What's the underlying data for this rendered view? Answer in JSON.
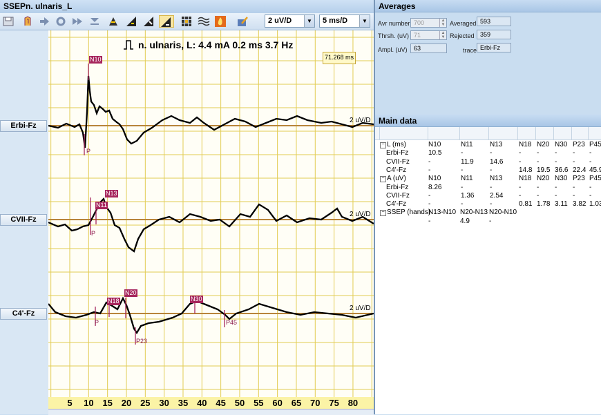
{
  "window": {
    "title": "SSEPn. ulnaris_L"
  },
  "toolbar": {
    "gain_select": "2 uV/D",
    "time_select": "5 ms/D",
    "icons": [
      "save-icon",
      "marker-icon",
      "play-icon",
      "repeat-icon",
      "fast-forward-icon",
      "skip-icon",
      "stimulator-icon",
      "ramp-icon",
      "ramp-alt-icon",
      "overlay-icon",
      "grid-icon",
      "filter-icon",
      "fire-icon",
      "edit-icon"
    ]
  },
  "plot": {
    "stimulus": "n. ulnaris, L: 4.4 mA  0.2 ms 3.7 Hz",
    "cursor_time": "71.268 ms",
    "x_ticks": [
      "5",
      "10",
      "15",
      "20",
      "25",
      "30",
      "35",
      "40",
      "45",
      "50",
      "55",
      "60",
      "65",
      "70",
      "75",
      "80"
    ],
    "channels": [
      {
        "label": "Erbi-Fz",
        "gain": "2 uV/D",
        "markers": [
          "N10"
        ],
        "points": [
          "P"
        ]
      },
      {
        "label": "CVII-Fz",
        "gain": "2 uV/D",
        "markers": [
          "N13",
          "N11"
        ],
        "points": [
          "P"
        ]
      },
      {
        "label": "C4'-Fz",
        "gain": "2 uV/D",
        "markers": [
          "N18",
          "N20",
          "N30"
        ],
        "points": [
          "P",
          "P23",
          "P45"
        ]
      }
    ],
    "colors": {
      "grid": "#e2cc52",
      "baseline": "#b8843a",
      "trace": "#000000",
      "marker": "#a6255c"
    }
  },
  "averages": {
    "title": "Averages",
    "avr_number_label": "Avr number",
    "avr_number": "700",
    "thrsh_label": "Thrsh. (uV)",
    "thrsh": "71",
    "ampl_label": "Ampl. (uV)",
    "ampl": "63",
    "averaged_label": "Averaged",
    "averaged": "593",
    "rejected_label": "Rejected",
    "rejected": "359",
    "trace_label": "trace",
    "trace": "Erbi-Fz"
  },
  "main_data": {
    "title": "Main data",
    "rows": [
      [
        "L (ms)",
        "N10",
        "N11",
        "N13",
        "N18",
        "N20",
        "N30",
        "P23",
        "P45"
      ],
      [
        "Erbi-Fz",
        "10.5",
        "-",
        "-",
        "-",
        "-",
        "-",
        "-",
        "-"
      ],
      [
        "CVII-Fz",
        "-",
        "11.9",
        "14.6",
        "-",
        "-",
        "-",
        "-",
        "-"
      ],
      [
        "C4'-Fz",
        "-",
        "-",
        "-",
        "14.8",
        "19.5",
        "36.6",
        "22.4",
        "45.9"
      ],
      [
        "A (uV)",
        "N10",
        "N11",
        "N13",
        "N18",
        "N20",
        "N30",
        "P23",
        "P45"
      ],
      [
        "Erbi-Fz",
        "8.26",
        "-",
        "-",
        "-",
        "-",
        "-",
        "-",
        "-"
      ],
      [
        "CVII-Fz",
        "-",
        "1.36",
        "2.54",
        "-",
        "-",
        "-",
        "-",
        "-"
      ],
      [
        "C4'-Fz",
        "-",
        "-",
        "-",
        "0.81",
        "1.78",
        "3.11",
        "3.82",
        "1.03"
      ],
      [
        "SSEP (hands)",
        "N13-N10",
        "N20-N13",
        "N20-N10",
        "",
        "",
        "",
        "",
        ""
      ],
      [
        "",
        "-",
        "4.9",
        "-",
        "",
        "",
        "",
        "",
        ""
      ]
    ]
  }
}
